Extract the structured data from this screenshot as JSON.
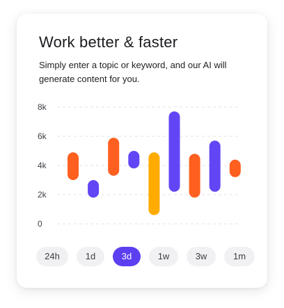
{
  "card": {
    "title": "Work better & faster",
    "subtitle": "Simply enter a topic or keyword, and our AI will generate content for you."
  },
  "filters": {
    "items": [
      "24h",
      "1d",
      "3d",
      "1w",
      "3w",
      "1m"
    ],
    "active": "3d",
    "active_color": "#5b3ff0"
  },
  "colors": {
    "orange": "#ff5f1f",
    "purple": "#6246f5",
    "yellow": "#ffab00"
  },
  "chart_data": {
    "type": "bar",
    "ylim": [
      0,
      8000
    ],
    "yticks": [
      "0",
      "2k",
      "4k",
      "6k",
      "8k"
    ],
    "ranges": [
      {
        "low": 3000,
        "high": 4900,
        "color": "orange"
      },
      {
        "low": 1800,
        "high": 3000,
        "color": "purple"
      },
      {
        "low": 3300,
        "high": 5900,
        "color": "orange"
      },
      {
        "low": 3800,
        "high": 5000,
        "color": "purple"
      },
      {
        "low": 600,
        "high": 4900,
        "color": "yellow"
      },
      {
        "low": 2200,
        "high": 7700,
        "color": "purple"
      },
      {
        "low": 1800,
        "high": 4800,
        "color": "orange"
      },
      {
        "low": 2200,
        "high": 5700,
        "color": "purple"
      },
      {
        "low": 3200,
        "high": 4400,
        "color": "orange"
      }
    ]
  }
}
